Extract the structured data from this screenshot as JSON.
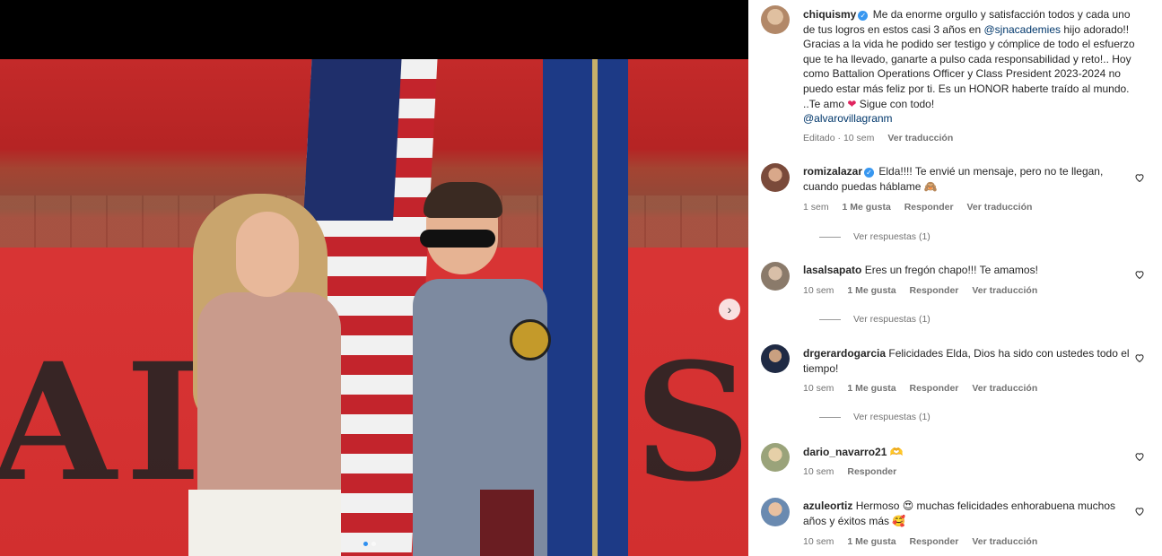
{
  "post": {
    "author": "chiquismy",
    "caption_before_mention": "Me da enorme orgullo y satisfacción todos y cada uno de tus logros en estos casi 3 años en",
    "mention1": "@sjnacademies",
    "caption_middle": "hijo adorado!! Gracias a la vida he podido ser testigo y cómplice de todo el esfuerzo que te ha llevado, ganarte a pulso cada responsabilidad y reto!.. Hoy como Battalion Operations Officer y Class President 2023-2024 no puedo estar más feliz por ti. Es un HONOR haberte traído al mundo. ..Te amo",
    "caption_after_heart": "Sigue con todo!",
    "mention2": "@alvarovillagranm",
    "edited": "Editado · 10 sem",
    "translate": "Ver traducción",
    "heart_emoji": "❤"
  },
  "media": {
    "banner_text": "AIDERS",
    "next_icon": "chevron-right-icon",
    "carousel_index": 1,
    "carousel_count": 2
  },
  "comments": [
    {
      "user": "romizalazar",
      "verified": true,
      "text": "Elda!!!! Te envié un mensaje, pero no te llegan, cuando puedas háblame 🙈",
      "time": "1 sem",
      "likes": "1 Me gusta",
      "reply": "Responder",
      "translate": "Ver traducción",
      "replies": "Ver respuestas (1)",
      "avatar_color": "#7a4a3a"
    },
    {
      "user": "lasalsapato",
      "verified": false,
      "text": "Eres un fregón chapo!!! Te amamos!",
      "time": "10 sem",
      "likes": "1 Me gusta",
      "reply": "Responder",
      "translate": "Ver traducción",
      "replies": "Ver respuestas (1)",
      "avatar_color": "#8a7a6a"
    },
    {
      "user": "drgerardogarcia",
      "verified": false,
      "text": "Felicidades Elda, Dios ha sido con ustedes todo el tiempo!",
      "time": "10 sem",
      "likes": "1 Me gusta",
      "reply": "Responder",
      "translate": "Ver traducción",
      "replies": "Ver respuestas (1)",
      "avatar_color": "#1f2a44"
    },
    {
      "user": "dario_navarro21",
      "verified": false,
      "text": "🫶",
      "time": "10 sem",
      "likes": "",
      "reply": "Responder",
      "translate": "",
      "replies": "",
      "avatar_color": "#9aa37a"
    },
    {
      "user": "azuleortiz",
      "verified": false,
      "text": "Hermoso 😍 muchas felicidades enhorabuena muchos años y éxitos más 🥰",
      "time": "10 sem",
      "likes": "1 Me gusta",
      "reply": "Responder",
      "translate": "Ver traducción",
      "replies": "",
      "avatar_color": "#6a8ab0"
    }
  ]
}
